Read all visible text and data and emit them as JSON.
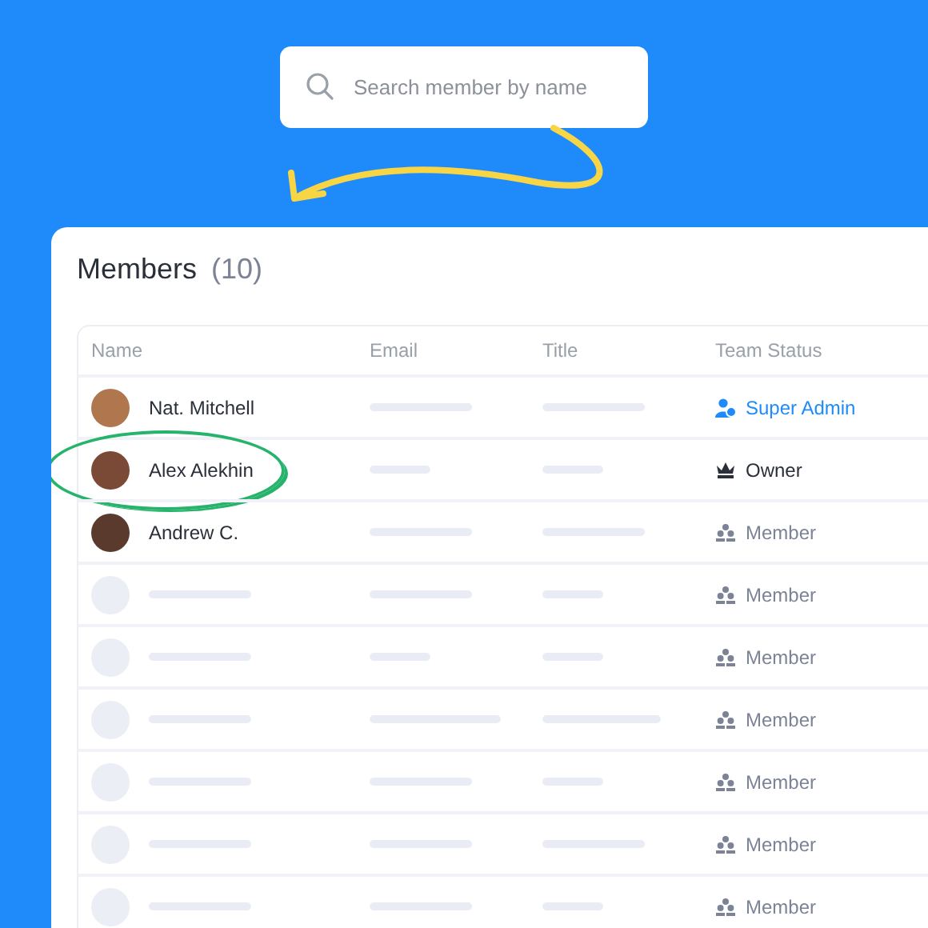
{
  "search": {
    "placeholder": "Search member by name"
  },
  "members_panel": {
    "title": "Members",
    "count": "(10)"
  },
  "table": {
    "columns": [
      "Name",
      "Email",
      "Title",
      "Team Status"
    ],
    "rows": [
      {
        "kind": "member",
        "name": "Nat. Mitchell",
        "circled": false,
        "status": {
          "kind": "super_admin",
          "label": "Super Admin"
        }
      },
      {
        "kind": "member",
        "name": "Alex Alekhin",
        "circled": true,
        "status": {
          "kind": "owner",
          "label": "Owner"
        }
      },
      {
        "kind": "member",
        "name": "Andrew C.",
        "circled": false,
        "status": {
          "kind": "member",
          "label": "Member"
        }
      },
      {
        "kind": "placeholder",
        "circled": false,
        "status": {
          "kind": "member",
          "label": "Member"
        }
      },
      {
        "kind": "placeholder",
        "circled": false,
        "status": {
          "kind": "member",
          "label": "Member"
        }
      },
      {
        "kind": "placeholder",
        "circled": false,
        "status": {
          "kind": "member",
          "label": "Member"
        }
      },
      {
        "kind": "placeholder",
        "circled": false,
        "status": {
          "kind": "member",
          "label": "Member"
        }
      },
      {
        "kind": "placeholder",
        "circled": false,
        "status": {
          "kind": "member",
          "label": "Member"
        }
      },
      {
        "kind": "placeholder",
        "circled": false,
        "status": {
          "kind": "member",
          "label": "Member"
        }
      }
    ]
  }
}
